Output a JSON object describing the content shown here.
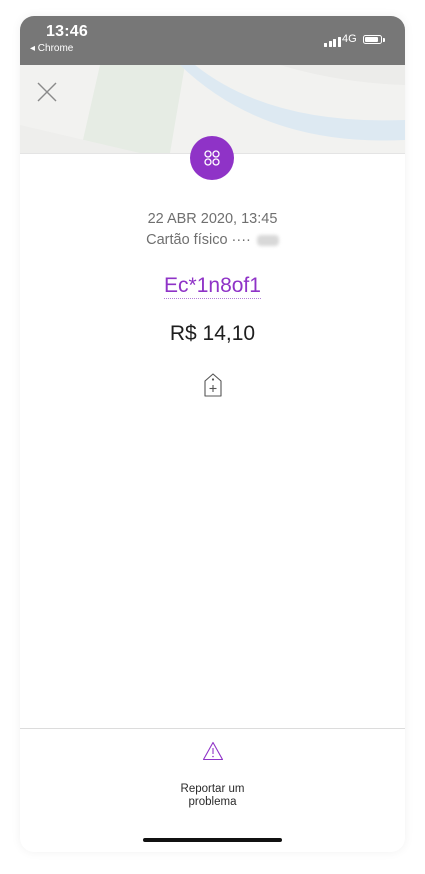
{
  "status_bar": {
    "time": "13:46",
    "back_app": "◂ Chrome",
    "network": "4G"
  },
  "transaction": {
    "date": "22 ABR 2020, 13:45",
    "card_label": "Cartão físico ····",
    "merchant": "Ec*1n8of1",
    "amount": "R$ 14,10"
  },
  "actions": {
    "report_label": "Reportar um\nproblema"
  },
  "colors": {
    "accent": "#8f33c7",
    "status_bar": "#777777"
  },
  "icons": {
    "close": "close-icon",
    "merchant_category": "category-dots-icon",
    "add_tag": "add-tag-icon",
    "report": "warning-icon"
  }
}
